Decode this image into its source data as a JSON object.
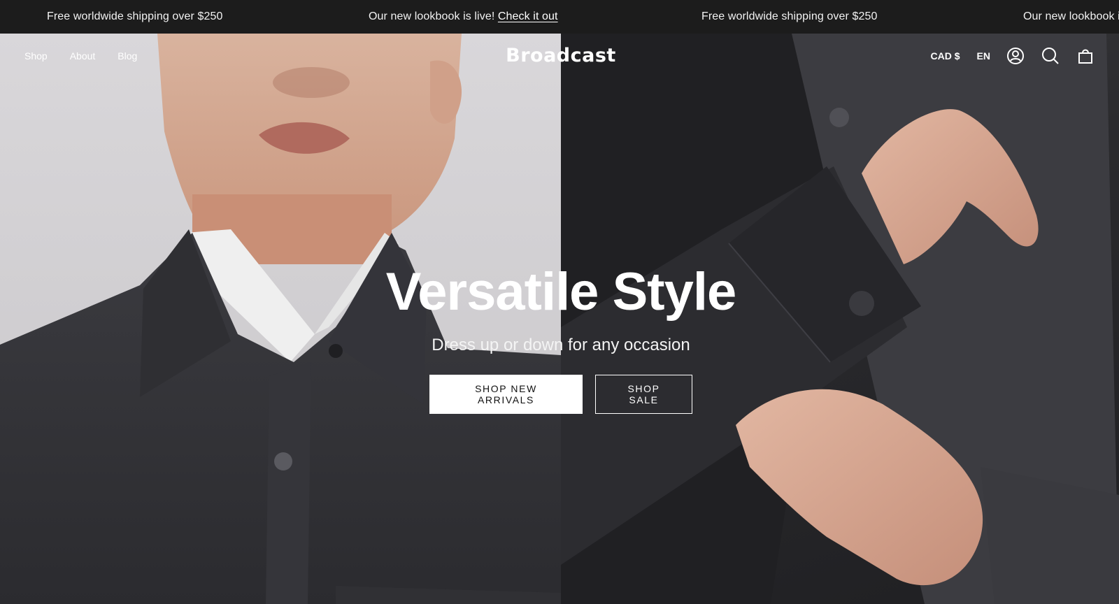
{
  "announcement": {
    "shipping_text": "Free worldwide shipping over $250",
    "lookbook_text": "Our new lookbook is live!",
    "lookbook_link": "Check it out",
    "lookbook_text_cut": "Our new lookbook is"
  },
  "header": {
    "nav": [
      "Shop",
      "About",
      "Blog"
    ],
    "logo": "Broadcast",
    "currency": "CAD $",
    "language": "EN",
    "icons": [
      "account-icon",
      "search-icon",
      "cart-icon"
    ]
  },
  "hero": {
    "headline": "Versatile Style",
    "subheadline": "Dress up or down for any occasion",
    "primary_cta": "SHOP NEW ARRIVALS",
    "secondary_cta": "SHOP SALE"
  },
  "colors": {
    "announcement_bg": "#1c1c1c",
    "primary_button_bg": "#ffffff",
    "text": "#ffffff"
  }
}
